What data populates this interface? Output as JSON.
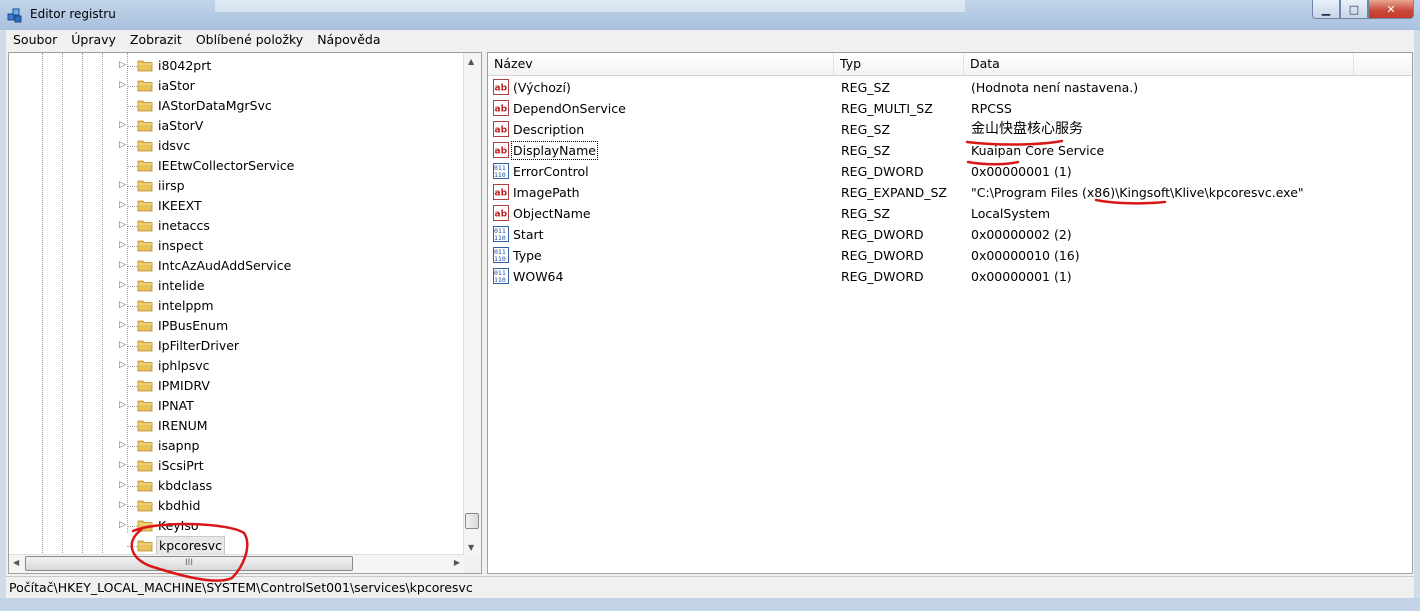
{
  "window": {
    "title": "Editor registru",
    "min_label": "▁",
    "max_label": "□",
    "close_label": "✕"
  },
  "menu": [
    "Soubor",
    "Úpravy",
    "Zobrazit",
    "Oblíbené položky",
    "Nápověda"
  ],
  "tree": {
    "items": [
      {
        "label": "i8042prt",
        "expandable": true
      },
      {
        "label": "iaStor",
        "expandable": true
      },
      {
        "label": "IAStorDataMgrSvc",
        "expandable": false
      },
      {
        "label": "iaStorV",
        "expandable": true
      },
      {
        "label": "idsvc",
        "expandable": true
      },
      {
        "label": "IEEtwCollectorService",
        "expandable": false
      },
      {
        "label": "iirsp",
        "expandable": true
      },
      {
        "label": "IKEEXT",
        "expandable": true
      },
      {
        "label": "inetaccs",
        "expandable": true
      },
      {
        "label": "inspect",
        "expandable": true
      },
      {
        "label": "IntcAzAudAddService",
        "expandable": true
      },
      {
        "label": "intelide",
        "expandable": true
      },
      {
        "label": "intelppm",
        "expandable": true
      },
      {
        "label": "IPBusEnum",
        "expandable": true
      },
      {
        "label": "IpFilterDriver",
        "expandable": true
      },
      {
        "label": "iphlpsvc",
        "expandable": true
      },
      {
        "label": "IPMIDRV",
        "expandable": false
      },
      {
        "label": "IPNAT",
        "expandable": true
      },
      {
        "label": "IRENUM",
        "expandable": false
      },
      {
        "label": "isapnp",
        "expandable": true
      },
      {
        "label": "iScsiPrt",
        "expandable": true
      },
      {
        "label": "kbdclass",
        "expandable": true
      },
      {
        "label": "kbdhid",
        "expandable": true
      },
      {
        "label": "KeyIso",
        "expandable": true
      },
      {
        "label": "kpcoresvc",
        "expandable": false,
        "selected": true
      }
    ],
    "hscroll_grip": "III"
  },
  "list": {
    "columns": [
      "Název",
      "Typ",
      "Data"
    ],
    "rows": [
      {
        "icon": "string-value-icon",
        "name": "(Výchozí)",
        "type": "REG_SZ",
        "data": "(Hodnota není nastavena.)"
      },
      {
        "icon": "string-value-icon",
        "name": "DependOnService",
        "type": "REG_MULTI_SZ",
        "data": "RPCSS"
      },
      {
        "icon": "string-value-icon",
        "name": "Description",
        "type": "REG_SZ",
        "data": "金山快盘核心服务",
        "cjk": true
      },
      {
        "icon": "string-value-icon",
        "name": "DisplayName",
        "type": "REG_SZ",
        "data": "Kuaipan Core Service",
        "focused": true
      },
      {
        "icon": "dword-value-icon",
        "name": "ErrorControl",
        "type": "REG_DWORD",
        "data": "0x00000001 (1)"
      },
      {
        "icon": "string-value-icon",
        "name": "ImagePath",
        "type": "REG_EXPAND_SZ",
        "data": "\"C:\\Program Files (x86)\\Kingsoft\\Klive\\kpcoresvc.exe\""
      },
      {
        "icon": "string-value-icon",
        "name": "ObjectName",
        "type": "REG_SZ",
        "data": "LocalSystem"
      },
      {
        "icon": "dword-value-icon",
        "name": "Start",
        "type": "REG_DWORD",
        "data": "0x00000002 (2)"
      },
      {
        "icon": "dword-value-icon",
        "name": "Type",
        "type": "REG_DWORD",
        "data": "0x00000010 (16)"
      },
      {
        "icon": "dword-value-icon",
        "name": "WOW64",
        "type": "REG_DWORD",
        "data": "0x00000001 (1)"
      }
    ]
  },
  "status": {
    "path": "Počítač\\HKEY_LOCAL_MACHINE\\SYSTEM\\ControlSet001\\services\\kpcoresvc"
  },
  "colors": {
    "annotation": "#d81818",
    "folder": "#e8c25a",
    "selection": "#e8e8e8"
  }
}
